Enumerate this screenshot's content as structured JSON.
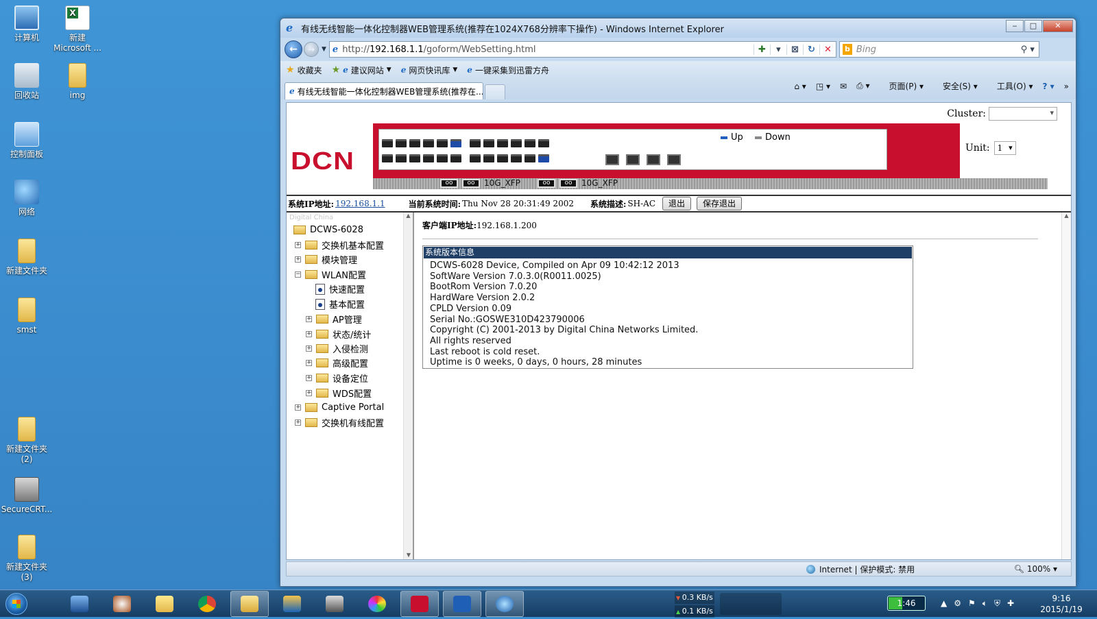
{
  "desktop": {
    "icons": [
      {
        "label": "计算机",
        "kind": "computer-icon"
      },
      {
        "label": "新建\nMicrosoft ...",
        "kind": "excel-icon"
      },
      {
        "label": "回收站",
        "kind": "recycle-bin-icon"
      },
      {
        "label": "img",
        "kind": "folder-icon"
      },
      {
        "label": "控制面板",
        "kind": "control-panel-icon"
      },
      {
        "label": "网络",
        "kind": "network-icon"
      },
      {
        "label": "新建文件夹",
        "kind": "folder-icon"
      },
      {
        "label": "smst",
        "kind": "shortcut-icon"
      },
      {
        "label": "新建文件夹\n(2)",
        "kind": "folder-icon"
      },
      {
        "label": "SecureCRT...",
        "kind": "securecrt-icon"
      },
      {
        "label": "新建文件夹\n(3)",
        "kind": "folder-icon"
      }
    ]
  },
  "browser": {
    "title": "有线无线智能一体化控制器WEB管理系统(推荐在1024X768分辨率下操作) - Windows Internet Explorer",
    "url_prefix": "http://",
    "url_host": "192.168.1.1",
    "url_path": "/goform/WebSetting.html",
    "search_placeholder": "Bing",
    "favorites": {
      "label": "收藏夹",
      "items": [
        "建议网站",
        "网页快讯库",
        "一键采集到迅雷方舟"
      ]
    },
    "tab_title": "有线无线智能一体化控制器WEB管理系统(推荐在...",
    "commands": [
      "页面(P)",
      "安全(S)",
      "工具(O)"
    ],
    "status": {
      "zone": "Internet | 保护模式: 禁用",
      "zoom": "100%"
    }
  },
  "app": {
    "cluster_label": "Cluster:",
    "logo": "DCN",
    "legend_up": "Up",
    "legend_down": "Down",
    "xfp_label": "10G_XFP",
    "unit_label": "Unit:",
    "unit_value": "1",
    "sys_ip_label": "系统IP地址:",
    "sys_ip": "192.168.1.1",
    "sys_time_label": "当前系统时间:",
    "sys_time": "Thu Nov 28 20:31:49 2002",
    "sys_desc_label": "系统描述:",
    "sys_desc": "SH-AC",
    "logout_btn": "退出",
    "save_logout_btn": "保存退出",
    "tree": {
      "watermark": "Digital China",
      "root": "DCWS-6028",
      "nodes": [
        "交换机基本配置",
        "模块管理",
        "WLAN配置",
        "快速配置",
        "基本配置",
        "AP管理",
        "状态/统计",
        "入侵检测",
        "高级配置",
        "设备定位",
        "WDS配置",
        "Captive Portal",
        "交换机有线配置"
      ]
    },
    "client_ip_label": "客户端IP地址:",
    "client_ip": "192.168.1.200",
    "version_title": "系统版本信息",
    "version_lines": [
      "DCWS-6028 Device, Compiled on Apr 09 10:42:12 2013",
      "SoftWare Version 7.0.3.0(R0011.0025)",
      "BootRom Version 7.0.20",
      "HardWare Version 2.0.2",
      "CPLD Version 0.09",
      "Serial No.:GOSWE310D423790006",
      "Copyright (C) 2001-2013 by Digital China Networks Limited.",
      "All rights reserved",
      "Last reboot is cold reset.",
      "Uptime is 0 weeks, 0 days, 0 hours, 28 minutes"
    ]
  },
  "taskbar": {
    "net_down": "0.3 KB/s",
    "net_up": "0.1 KB/s",
    "battery": "1:46",
    "time": "9:16",
    "date": "2015/1/19"
  },
  "colors": {
    "brand_red": "#c8102e",
    "legend_up": "#1f5fbf",
    "legend_down": "#888888",
    "version_header": "#1f3f66"
  }
}
